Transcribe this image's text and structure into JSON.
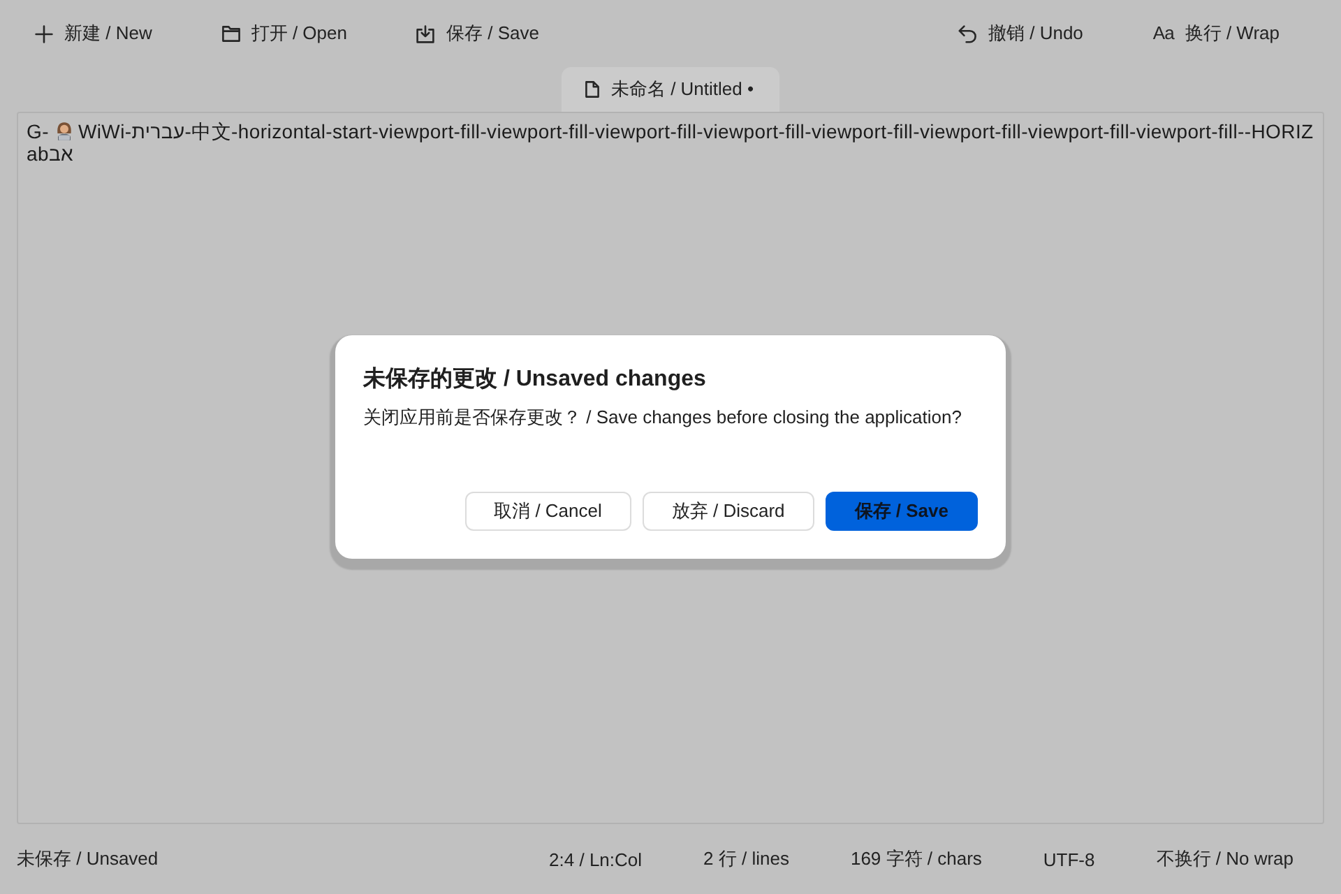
{
  "toolbar": {
    "left": [
      {
        "label": "新建 / New"
      },
      {
        "label": "打开 / Open"
      },
      {
        "label": "保存 / Save"
      }
    ],
    "right": [
      {
        "label": "撤销 / Undo"
      },
      {
        "glyph": "Aa",
        "label": "换行 / Wrap"
      }
    ]
  },
  "tab": {
    "label": "未命名 / Untitled •",
    "selected": true
  },
  "editor": {
    "lines": [
      {
        "segments": [
          {
            "kind": "text",
            "text": "G-"
          },
          {
            "kind": "emoji"
          },
          {
            "kind": "text",
            "text": "WiWi-עברית-中文-horizontal-start-viewport-fill-viewport-fill-viewport-fill-viewport-fill-viewport-fill-viewport-fill-viewport-fill-viewport-fill--HORIZ"
          }
        ]
      },
      {
        "segments": [
          {
            "kind": "text",
            "text": "abאב"
          }
        ]
      }
    ]
  },
  "dialog": {
    "title": "未保存的更改 / Unsaved changes",
    "message": "关闭应用前是否保存更改？ / Save changes before closing the application?",
    "buttons": [
      {
        "label": "取消 / Cancel",
        "kind": "secondary"
      },
      {
        "label": "放弃 / Discard",
        "kind": "secondary"
      },
      {
        "label": "保存 / Save",
        "kind": "primary"
      }
    ]
  },
  "status_bar": {
    "state": "未保存 / Unsaved",
    "items": [
      "2:4 / Ln:Col",
      "2 行 / lines",
      "169 字符 / chars",
      "UTF-8",
      "不换行 / No wrap"
    ]
  }
}
